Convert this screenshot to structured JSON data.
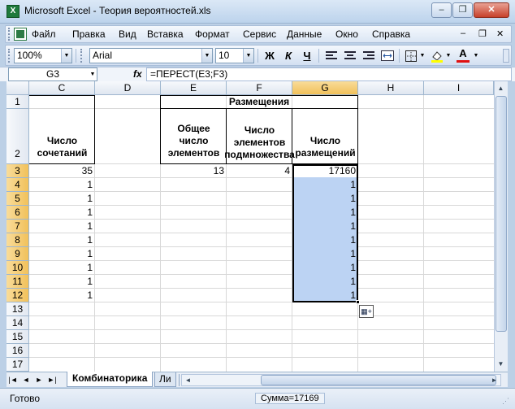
{
  "window": {
    "title": "Microsoft Excel - Теория вероятностей.xls",
    "app_icon": "X",
    "minimize": "–",
    "restore": "❐",
    "close": "✕"
  },
  "menu": {
    "doc_icon": "excel-doc-icon",
    "items": [
      {
        "label": "Файл"
      },
      {
        "label": "Правка"
      },
      {
        "label": "Вид"
      },
      {
        "label": "Вставка"
      },
      {
        "label": "Формат"
      },
      {
        "label": "Сервис"
      },
      {
        "label": "Данные"
      },
      {
        "label": "Окно"
      },
      {
        "label": "Справка"
      }
    ],
    "doc_min": "–",
    "doc_restore": "❐",
    "doc_close": "✕"
  },
  "toolbar": {
    "zoom": "100%",
    "font": "Arial",
    "font_size": "10",
    "bold": "Ж",
    "italic": "К",
    "underline": "Ч",
    "font_color_letter": "A",
    "icons": [
      "align-left-icon",
      "align-center-icon",
      "align-right-icon",
      "merge-center-icon",
      "borders-icon",
      "fill-color-icon",
      "font-color-icon"
    ]
  },
  "formula_bar": {
    "name_box": "G3",
    "fx": "fx",
    "formula": "=ПЕРЕСТ(E3;F3)"
  },
  "grid": {
    "columns": [
      {
        "label": "C"
      },
      {
        "label": "D"
      },
      {
        "label": "E"
      },
      {
        "label": "F"
      },
      {
        "label": "G",
        "selected": true
      },
      {
        "label": "H"
      },
      {
        "label": "I"
      }
    ],
    "rows": [
      "1",
      "2",
      "3",
      "4",
      "5",
      "6",
      "7",
      "8",
      "9",
      "10",
      "11",
      "12",
      "13",
      "14",
      "15",
      "16",
      "17"
    ],
    "merged_header": "Размещения",
    "c2_header": "Число сочетаний",
    "e2_header": "Общее число элементов",
    "f2_header": "Число элементов подмножества",
    "g2_header": "Число размещений",
    "c_values": [
      "35",
      "1",
      "1",
      "1",
      "1",
      "1",
      "1",
      "1",
      "1",
      "1"
    ],
    "e3": "13",
    "f3": "4",
    "g_values": [
      "17160",
      "1",
      "1",
      "1",
      "1",
      "1",
      "1",
      "1",
      "1",
      "1"
    ]
  },
  "sheets": {
    "nav": [
      "|◄",
      "◄",
      "►",
      "►|"
    ],
    "active": "Комбинаторика",
    "next": "Ли"
  },
  "status": {
    "ready": "Готово",
    "sum": "Сумма=17169"
  },
  "colors": {
    "selection": "#bcd3f3",
    "header_selected": "#f1c15a",
    "accent": "#1e7a3c"
  }
}
